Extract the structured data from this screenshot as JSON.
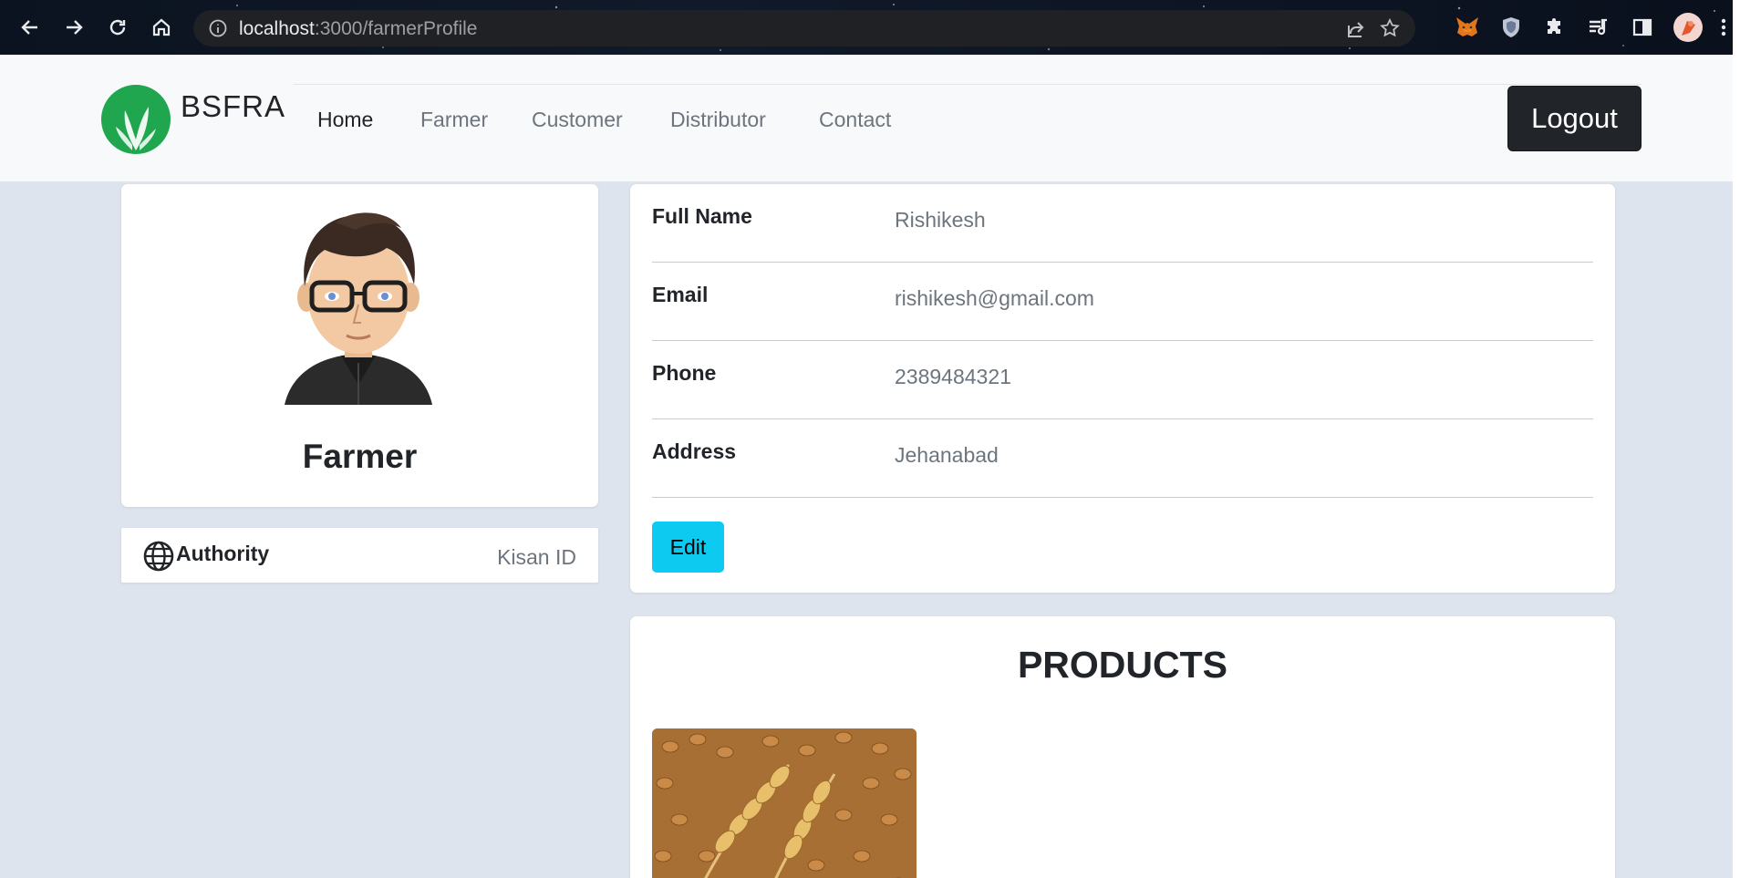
{
  "browser": {
    "url_host": "localhost",
    "url_path": ":3000/farmerProfile"
  },
  "navbar": {
    "brand": "BSFRA",
    "links": [
      {
        "label": "Home"
      },
      {
        "label": "Farmer"
      },
      {
        "label": "Customer"
      },
      {
        "label": "Distributor"
      },
      {
        "label": "Contact"
      }
    ],
    "logout_label": "Logout"
  },
  "profile": {
    "role": "Farmer",
    "authority_label": "Authority",
    "authority_value": "Kisan ID"
  },
  "details": {
    "rows": [
      {
        "label": "Full Name",
        "value": "Rishikesh"
      },
      {
        "label": "Email",
        "value": "rishikesh@gmail.com"
      },
      {
        "label": "Phone",
        "value": "2389484321"
      },
      {
        "label": "Address",
        "value": "Jehanabad"
      }
    ],
    "edit_label": "Edit"
  },
  "products": {
    "title": "PRODUCTS"
  },
  "colors": {
    "page_bg": "#dee4ed",
    "navbar_bg": "#f8f9fa",
    "logout_bg": "#212529",
    "edit_bg": "#0dcaf0",
    "logo_green": "#1fa64f"
  }
}
